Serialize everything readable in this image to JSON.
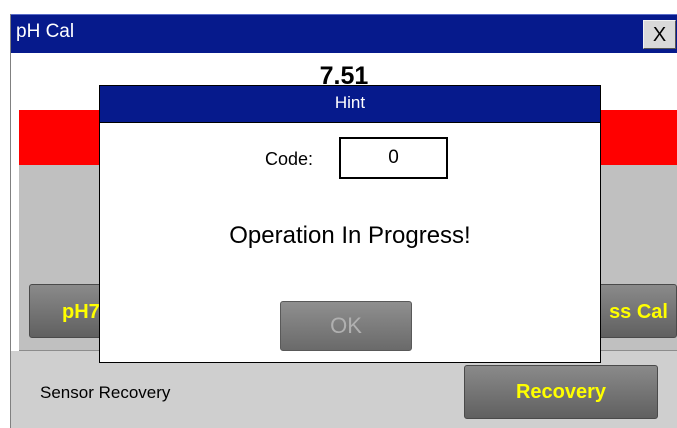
{
  "window": {
    "title": "pH Cal",
    "close_label": "X"
  },
  "reading": {
    "ph_value": "7.51"
  },
  "calibration": {
    "ph7_button_label": "pH7",
    "press_cal_button_label": "ss Cal"
  },
  "recovery": {
    "sensor_label": "Sensor Recovery",
    "button_label": "Recovery"
  },
  "dialog": {
    "title": "Hint",
    "code_label": "Code:",
    "code_value": "0",
    "message": "Operation In Progress!",
    "ok_label": "OK",
    "ok_enabled": false
  },
  "colors": {
    "titlebar": "#061a8c",
    "status_bar": "#ff0000",
    "button_text": "#ffff00",
    "panel": "#c0c0c0"
  }
}
